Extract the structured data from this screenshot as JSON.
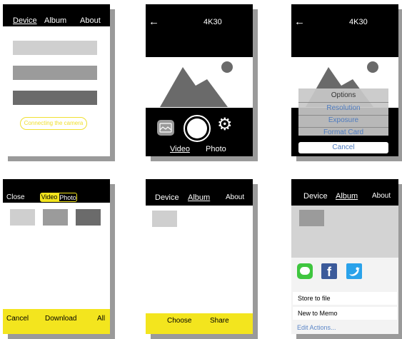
{
  "screen1": {
    "tabs": [
      "Device",
      "Album",
      "About"
    ],
    "status": "Connecting the camera",
    "accent": "#f0e030"
  },
  "screen2": {
    "back": "←",
    "title": "4K30",
    "modes": [
      "Video",
      "Photo"
    ],
    "icons": [
      "gallery-icon",
      "shutter-button",
      "gear-icon"
    ]
  },
  "screen3": {
    "back": "←",
    "title": "4K30",
    "sheet": {
      "header": "Options",
      "items": [
        "Resolution",
        "Exposure",
        "Format Card"
      ],
      "cancel": "Cancel"
    }
  },
  "screen4": {
    "close": "Close",
    "toggle": [
      "Video",
      "Photo"
    ],
    "footer": [
      "Cancel",
      "Download",
      "All"
    ]
  },
  "screen5": {
    "tabs": [
      "Device",
      "Album",
      "About"
    ],
    "footer": [
      "Choose",
      "Share"
    ]
  },
  "screen6": {
    "tabs": [
      "Device",
      "Album",
      "About"
    ],
    "share_icons": [
      "messages-icon",
      "facebook-icon",
      "twitter-icon"
    ],
    "actions": [
      "Store to file",
      "New to Memo"
    ],
    "edit": "Edit Actions..."
  }
}
